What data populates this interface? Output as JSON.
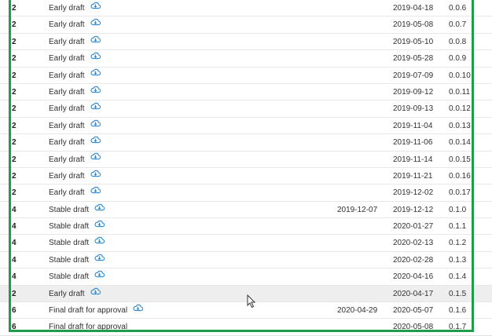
{
  "colors": {
    "frame": "#1e9e48",
    "icon": "#2b88d8",
    "row_highlight": "#eeeeee"
  },
  "icons": {
    "sync": "cloud-sync-icon",
    "cursor": "mouse-cursor-icon"
  },
  "rows": [
    {
      "num": "2",
      "name": "Early draft",
      "icon": true,
      "date1": "",
      "date2": "2019-04-18",
      "version": "0.0.6"
    },
    {
      "num": "2",
      "name": "Early draft",
      "icon": true,
      "date1": "",
      "date2": "2019-05-08",
      "version": "0.0.7"
    },
    {
      "num": "2",
      "name": "Early draft",
      "icon": true,
      "date1": "",
      "date2": "2019-05-10",
      "version": "0.0.8"
    },
    {
      "num": "2",
      "name": "Early draft",
      "icon": true,
      "date1": "",
      "date2": "2019-05-28",
      "version": "0.0.9"
    },
    {
      "num": "2",
      "name": "Early draft",
      "icon": true,
      "date1": "",
      "date2": "2019-07-09",
      "version": "0.0.10"
    },
    {
      "num": "2",
      "name": "Early draft",
      "icon": true,
      "date1": "",
      "date2": "2019-09-12",
      "version": "0.0.11"
    },
    {
      "num": "2",
      "name": "Early draft",
      "icon": true,
      "date1": "",
      "date2": "2019-09-13",
      "version": "0.0.12"
    },
    {
      "num": "2",
      "name": "Early draft",
      "icon": true,
      "date1": "",
      "date2": "2019-11-04",
      "version": "0.0.13"
    },
    {
      "num": "2",
      "name": "Early draft",
      "icon": true,
      "date1": "",
      "date2": "2019-11-06",
      "version": "0.0.14"
    },
    {
      "num": "2",
      "name": "Early draft",
      "icon": true,
      "date1": "",
      "date2": "2019-11-14",
      "version": "0.0.15"
    },
    {
      "num": "2",
      "name": "Early draft",
      "icon": true,
      "date1": "",
      "date2": "2019-11-21",
      "version": "0.0.16"
    },
    {
      "num": "2",
      "name": "Early draft",
      "icon": true,
      "date1": "",
      "date2": "2019-12-02",
      "version": "0.0.17"
    },
    {
      "num": "4",
      "name": "Stable draft",
      "icon": true,
      "date1": "2019-12-07",
      "date2": "2019-12-12",
      "version": "0.1.0"
    },
    {
      "num": "4",
      "name": "Stable draft",
      "icon": true,
      "date1": "",
      "date2": "2020-01-27",
      "version": "0.1.1"
    },
    {
      "num": "4",
      "name": "Stable draft",
      "icon": true,
      "date1": "",
      "date2": "2020-02-13",
      "version": "0.1.2"
    },
    {
      "num": "4",
      "name": "Stable draft",
      "icon": true,
      "date1": "",
      "date2": "2020-02-28",
      "version": "0.1.3"
    },
    {
      "num": "4",
      "name": "Stable draft",
      "icon": true,
      "date1": "",
      "date2": "2020-04-16",
      "version": "0.1.4"
    },
    {
      "num": "2",
      "name": "Early draft",
      "icon": true,
      "date1": "",
      "date2": "2020-04-17",
      "version": "0.1.5",
      "highlight": true
    },
    {
      "num": "6",
      "name": "Final draft for approval",
      "icon": true,
      "date1": "2020-04-29",
      "date2": "2020-05-07",
      "version": "0.1.6"
    },
    {
      "num": "6",
      "name": "Final draft for approval",
      "icon": false,
      "date1": "",
      "date2": "2020-05-08",
      "version": "0.1.7"
    }
  ]
}
